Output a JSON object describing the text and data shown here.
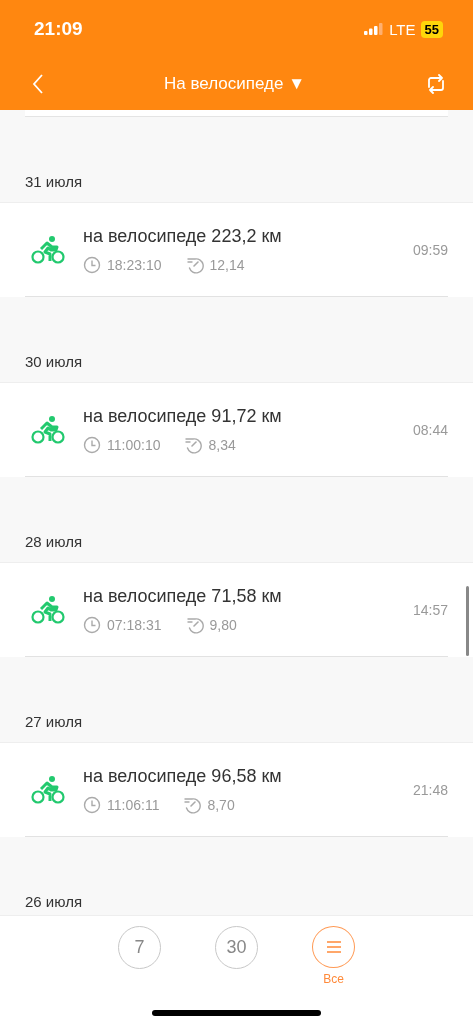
{
  "status_bar": {
    "time": "21:09",
    "network": "LTE",
    "battery": "55"
  },
  "nav": {
    "title": "На велосипеде",
    "title_caret": "▼"
  },
  "days": [
    {
      "date": "31 июля",
      "activities": [
        {
          "title": "на велосипеде 223,2 км",
          "duration": "18:23:10",
          "pace": "12,14",
          "time": "09:59"
        }
      ]
    },
    {
      "date": "30 июля",
      "activities": [
        {
          "title": "на велосипеде 91,72 км",
          "duration": "11:00:10",
          "pace": "8,34",
          "time": "08:44"
        }
      ]
    },
    {
      "date": "28 июля",
      "activities": [
        {
          "title": "на велосипеде 71,58 км",
          "duration": "07:18:31",
          "pace": "9,80",
          "time": "14:57"
        }
      ]
    },
    {
      "date": "27 июля",
      "activities": [
        {
          "title": "на велосипеде 96,58 км",
          "duration": "11:06:11",
          "pace": "8,70",
          "time": "21:48"
        }
      ]
    },
    {
      "date": "26 июля"
    }
  ],
  "tabs": [
    {
      "kind": "number",
      "text": "7",
      "selected": false
    },
    {
      "kind": "number",
      "text": "30",
      "selected": false
    },
    {
      "kind": "list",
      "caption": "Все",
      "selected": true
    }
  ]
}
